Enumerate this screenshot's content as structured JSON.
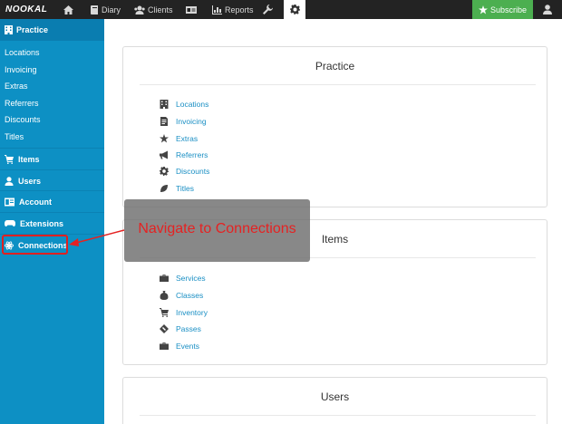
{
  "topbar": {
    "logo": "NOOKAL",
    "nav": [
      {
        "label": "",
        "icon": "home-icon"
      },
      {
        "label": "Diary",
        "icon": "book-icon"
      },
      {
        "label": "Clients",
        "icon": "users-icon"
      },
      {
        "label": "",
        "icon": "id-card-icon"
      },
      {
        "label": "Reports",
        "icon": "bar-chart-icon"
      },
      {
        "label": "",
        "icon": "wrench-icon"
      },
      {
        "label": "",
        "icon": "gear-icon"
      }
    ],
    "subscribe_label": "Subscribe",
    "colors": {
      "bar": "#232323",
      "subscribe": "#4caf50"
    }
  },
  "sidebar": {
    "header": "Practice",
    "sub_items": [
      "Locations",
      "Invoicing",
      "Extras",
      "Referrers",
      "Discounts",
      "Titles"
    ],
    "sections": [
      "Items",
      "Users",
      "Account",
      "Extensions",
      "Connections"
    ],
    "colors": {
      "bg": "#0d90c4",
      "header": "#0a7db0"
    }
  },
  "cards": {
    "practice": {
      "title": "Practice",
      "links": [
        "Locations",
        "Invoicing",
        "Extras",
        "Referrers",
        "Discounts",
        "Titles"
      ]
    },
    "items": {
      "title": "Items",
      "links": [
        "Services",
        "Classes",
        "Inventory",
        "Passes",
        "Events"
      ]
    },
    "users": {
      "title": "Users"
    }
  },
  "annotation": {
    "text": "Navigate to Connections",
    "color": "#e52222"
  }
}
